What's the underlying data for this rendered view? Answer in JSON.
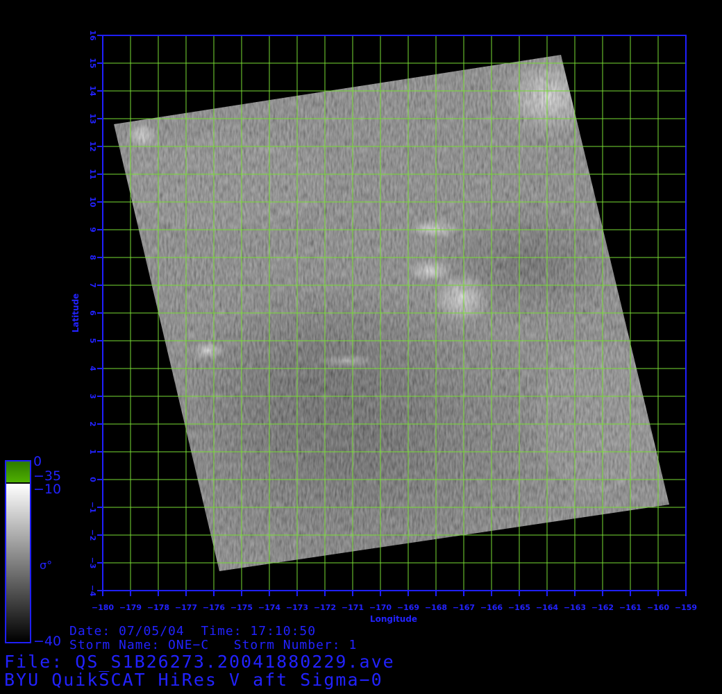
{
  "plot": {
    "xlabel": "Longitude",
    "ylabel": "Latitude",
    "lon_range": [
      -180,
      -159
    ],
    "lat_range": [
      -4,
      16
    ],
    "lon_ticks": [
      -180,
      -179,
      -178,
      -177,
      -176,
      -175,
      -174,
      -173,
      -172,
      -171,
      -170,
      -169,
      -168,
      -167,
      -166,
      -165,
      -164,
      -163,
      -162,
      -161,
      -160,
      -159
    ],
    "lat_ticks": [
      -4,
      -3,
      -2,
      -1,
      0,
      1,
      2,
      3,
      4,
      5,
      6,
      7,
      8,
      9,
      10,
      11,
      12,
      13,
      14,
      15,
      16
    ],
    "grid": true,
    "swath_corners": [
      {
        "lon": -179.6,
        "lat": 12.8
      },
      {
        "lon": -163.5,
        "lat": 15.3
      },
      {
        "lon": -159.6,
        "lat": -0.9
      },
      {
        "lon": -175.8,
        "lat": -3.3
      }
    ]
  },
  "colorbar": {
    "top_label": "0",
    "green_bottom_label": "−35",
    "gray_top_label": "−10",
    "bottom_label": "−40",
    "symbol": "σ°"
  },
  "info": {
    "date_line": "Date: 07/05/04  Time: 17:10:50",
    "storm_line": "Storm Name: ONE−C   Storm Number: 1",
    "file_line": "File: QS_S1B26273.20041880229.ave",
    "product_line": "BYU QuikSCAT HiRes V aft Sigma−0"
  },
  "colors": {
    "axis": "#1f1fff",
    "grid": "#77dd33",
    "text": "#2222ff",
    "background": "#000000",
    "colorbar_green": "#3a8a00"
  }
}
